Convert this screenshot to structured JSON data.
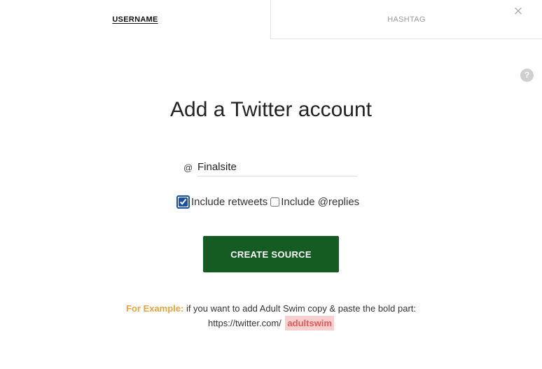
{
  "tabs": {
    "username": "USERNAME",
    "hashtag": "HASHTAG"
  },
  "icons": {
    "close": "×",
    "help": "?"
  },
  "form": {
    "title": "Add a Twitter account",
    "at_sign": "@",
    "username_value": "Finalsite",
    "include_retweets_label": "Include retweets",
    "include_retweets_checked": true,
    "include_replies_label": "Include @replies",
    "include_replies_checked": false,
    "submit_label": "CREATE SOURCE"
  },
  "example": {
    "label": "For Example:",
    "text": " if you want to add Adult Swim copy & paste the bold part:",
    "url_prefix": "https://twitter.com/",
    "bold_part": "adultswim"
  },
  "colors": {
    "button_bg": "#155c23",
    "example_label": "#e8a33c",
    "highlight_bg": "#f7cfcf",
    "highlight_text": "#e35a5a",
    "checkbox_focus": "#1b4fa3"
  }
}
